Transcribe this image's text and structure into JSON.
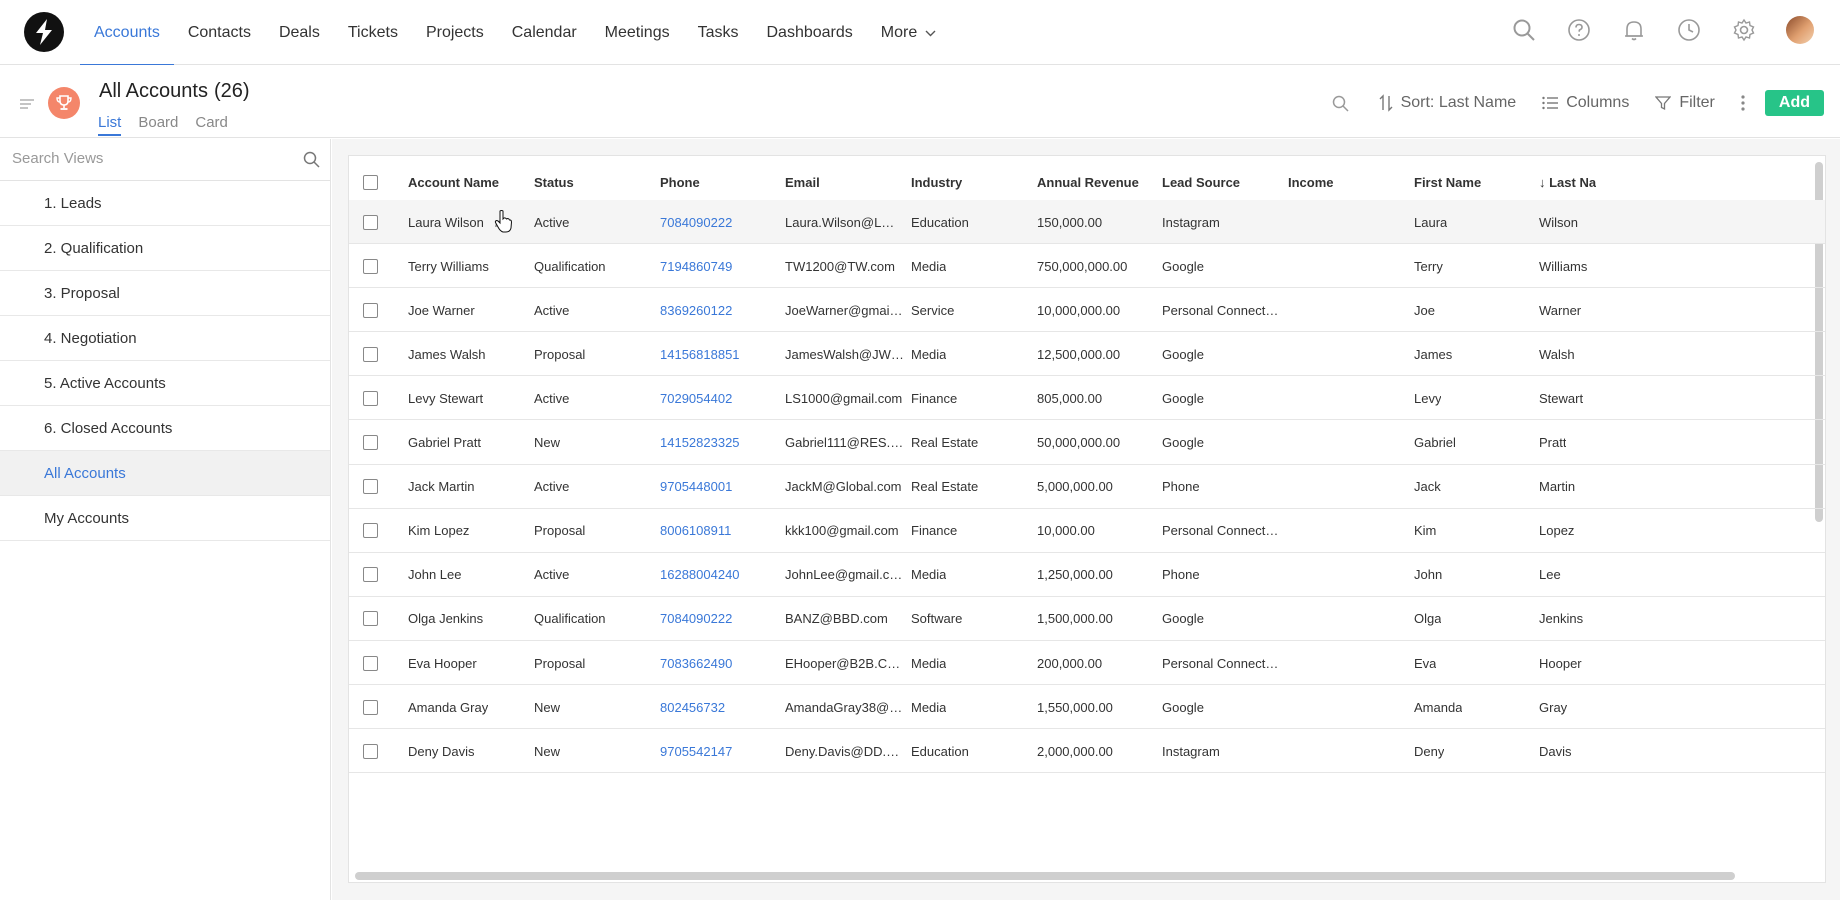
{
  "nav": {
    "tabs": [
      "Accounts",
      "Contacts",
      "Deals",
      "Tickets",
      "Projects",
      "Calendar",
      "Meetings",
      "Tasks",
      "Dashboards",
      "More"
    ],
    "active": "Accounts",
    "icons": [
      "search-icon",
      "help-icon",
      "bell-icon",
      "history-icon",
      "gear-icon",
      "avatar"
    ]
  },
  "header": {
    "title": "All Accounts",
    "count": "(26)",
    "view_tabs": [
      "List",
      "Board",
      "Card"
    ],
    "active_view": "List"
  },
  "toolbar": {
    "sort_label": "Sort: Last Name",
    "columns_label": "Columns",
    "filter_label": "Filter",
    "add_label": "Add"
  },
  "sidebar": {
    "search_placeholder": "Search Views",
    "items": [
      "1. Leads",
      "2. Qualification",
      "3. Proposal",
      "4. Negotiation",
      "5. Active Accounts",
      "6. Closed Accounts",
      "All Accounts",
      "My Accounts"
    ],
    "active": "All Accounts"
  },
  "table": {
    "columns": [
      "Account Name",
      "Status",
      "Phone",
      "Email",
      "Industry",
      "Annual Revenue",
      "Lead Source",
      "Income",
      "First Name",
      "Last Name"
    ],
    "sort_column_label": "↓ Last Na",
    "rows": [
      [
        "Laura Wilson",
        "Active",
        "7084090222",
        "Laura.Wilson@L…",
        "Education",
        "150,000.00",
        "Instagram",
        "",
        "Laura",
        "Wilson"
      ],
      [
        "Terry Williams",
        "Qualification",
        "7194860749",
        "TW1200@TW.com",
        "Media",
        "750,000,000.00",
        "Google",
        "",
        "Terry",
        "Williams"
      ],
      [
        "Joe Warner",
        "Active",
        "8369260122",
        "JoeWarner@gmai…",
        "Service",
        "10,000,000.00",
        "Personal Connect…",
        "",
        "Joe",
        "Warner"
      ],
      [
        "James Walsh",
        "Proposal",
        "14156818851",
        "JamesWalsh@JW…",
        "Media",
        "12,500,000.00",
        "Google",
        "",
        "James",
        "Walsh"
      ],
      [
        "Levy Stewart",
        "Active",
        "7029054402",
        "LS1000@gmail.com",
        "Finance",
        "805,000.00",
        "Google",
        "",
        "Levy",
        "Stewart"
      ],
      [
        "Gabriel Pratt",
        "New",
        "14152823325",
        "Gabriel111@RES.…",
        "Real Estate",
        "50,000,000.00",
        "Google",
        "",
        "Gabriel",
        "Pratt"
      ],
      [
        "Jack Martin",
        "Active",
        "9705448001",
        "JackM@Global.com",
        "Real Estate",
        "5,000,000.00",
        "Phone",
        "",
        "Jack",
        "Martin"
      ],
      [
        "Kim Lopez",
        "Proposal",
        "8006108911",
        "kkk100@gmail.com",
        "Finance",
        "10,000.00",
        "Personal Connect…",
        "",
        "Kim",
        "Lopez"
      ],
      [
        "John Lee",
        "Active",
        "16288004240",
        "JohnLee@gmail.c…",
        "Media",
        "1,250,000.00",
        "Phone",
        "",
        "John",
        "Lee"
      ],
      [
        "Olga Jenkins",
        "Qualification",
        "7084090222",
        "BANZ@BBD.com",
        "Software",
        "1,500,000.00",
        "Google",
        "",
        "Olga",
        "Jenkins"
      ],
      [
        "Eva Hooper",
        "Proposal",
        "7083662490",
        "EHooper@B2B.C…",
        "Media",
        "200,000.00",
        "Personal Connect…",
        "",
        "Eva",
        "Hooper"
      ],
      [
        "Amanda Gray",
        "New",
        "802456732",
        "AmandaGray38@…",
        "Media",
        "1,550,000.00",
        "Google",
        "",
        "Amanda",
        "Gray"
      ],
      [
        "Deny Davis",
        "New",
        "9705542147",
        "Deny.Davis@DD.…",
        "Education",
        "2,000,000.00",
        "Instagram",
        "",
        "Deny",
        "Davis"
      ]
    ]
  },
  "colors": {
    "accent": "#3a78d8",
    "add_button": "#27c488",
    "trophy": "#f4866a"
  }
}
